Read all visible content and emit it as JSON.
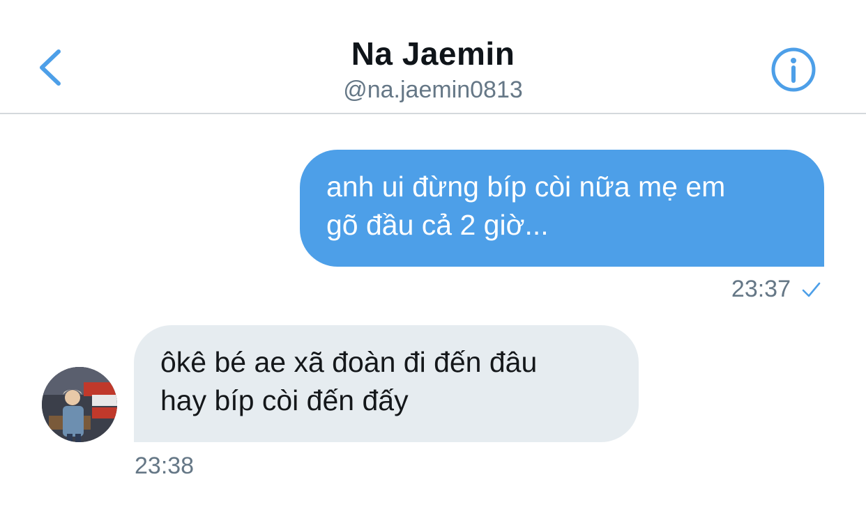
{
  "header": {
    "title": "Na Jaemin",
    "handle": "@na.jaemin0813",
    "back_icon": "chevron-left-icon",
    "info_icon": "info-icon",
    "accent_color": "#4d9fe8"
  },
  "messages": [
    {
      "direction": "sent",
      "lines": [
        "anh ui đừng bíp còi nữa mẹ em",
        "gõ đầu cả 2 giờ..."
      ],
      "time": "23:37",
      "status_icon": "check-icon",
      "bubble_color": "#4d9fe8"
    },
    {
      "direction": "received",
      "lines": [
        "ôkê bé ae xã đoàn đi đến đâu",
        "hay bíp còi đến đấy"
      ],
      "time": "23:38",
      "avatar": "avatar-photo",
      "bubble_color": "#e6ecf0"
    }
  ]
}
